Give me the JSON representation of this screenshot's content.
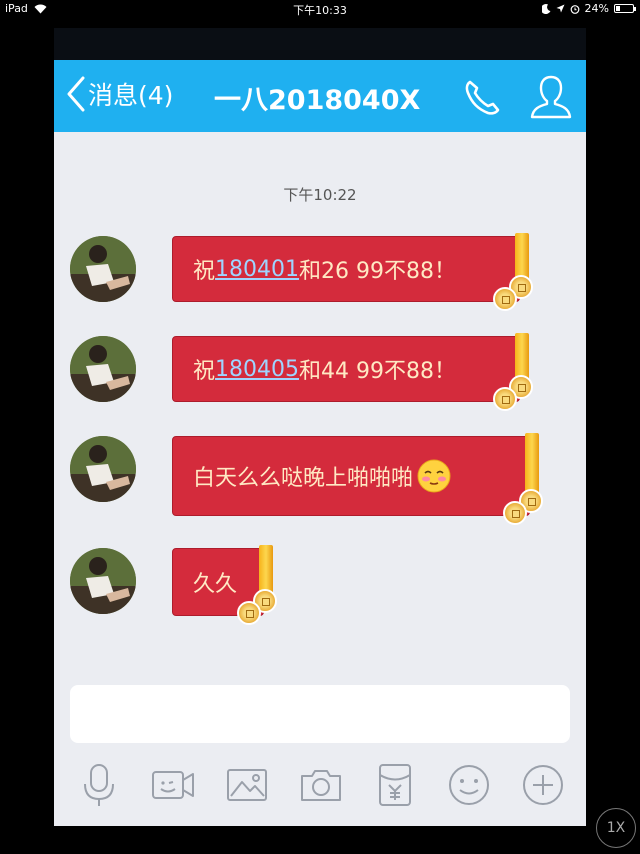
{
  "status_bar": {
    "device": "iPad",
    "time": "下午10:33",
    "battery": "24%",
    "battery_level": 0.24
  },
  "header": {
    "back_label": "消息(4)",
    "title": "一八2018040X"
  },
  "chat": {
    "timestamp": "下午10:22",
    "messages": [
      {
        "prefix": "祝",
        "number": "180401",
        "suffix": "和26 99不88！"
      },
      {
        "prefix": "祝",
        "number": "180405",
        "suffix": "和44 99不88！"
      },
      {
        "text": "白天么么哒晚上啪啪啪",
        "emoji": "shy-face-emoji"
      },
      {
        "text": "久久"
      }
    ]
  },
  "toolbar": {
    "icons": [
      "microphone-icon",
      "video-call-icon",
      "image-icon",
      "camera-icon",
      "red-packet-icon",
      "emoji-icon",
      "plus-icon"
    ]
  },
  "overlay": {
    "speed": "1X"
  },
  "colors": {
    "header": "#1fb0f0",
    "bubble": "#d42b3c",
    "bubble_text": "#ffe9c4",
    "link": "#9fd4ff",
    "background": "#ebedf2"
  }
}
